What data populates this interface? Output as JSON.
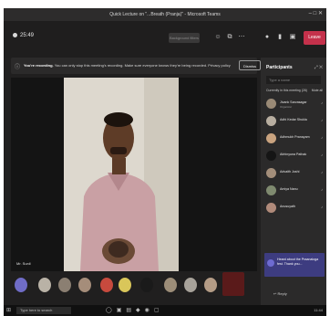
{
  "window": {
    "title": "Quick Lecture on \"...Breath (Pranja)\" - Microsoft Teams",
    "controls": "–  □  ✕"
  },
  "toolbar": {
    "timer": "25:49",
    "background_button": "Background filters",
    "tools": [
      "☺",
      "⧉",
      "⋯",
      "●",
      "▮",
      "▣"
    ],
    "leave_label": "Leave"
  },
  "banner": {
    "title": "You're recording.",
    "text": "You can only stop this meeting's recording. Make sure everyone knows they're being recorded. Privacy policy",
    "dismiss_label": "Dismiss"
  },
  "video": {
    "speaker_name": "Mr. Sunil"
  },
  "participants_panel": {
    "title": "Participants",
    "search_placeholder": "Type a name",
    "section_title": "Currently in this meeting (26)",
    "mute_all": "Mute all",
    "items": [
      {
        "name": "Jivank Sarvasagar",
        "role": "Organizer"
      },
      {
        "name": "Adhi Kedar Shukla",
        "role": ""
      },
      {
        "name": "Adhmukh Pranayam",
        "role": ""
      },
      {
        "name": "Abhinyuna Pathak",
        "role": ""
      },
      {
        "name": "Advaith Joshi",
        "role": ""
      },
      {
        "name": "Amiya Nanu",
        "role": ""
      },
      {
        "name": "Anusuyath",
        "role": ""
      }
    ]
  },
  "notification": {
    "text": "Heard about the Praanaloga fest. Thank you..."
  },
  "reply_label": "Reply",
  "taskbar": {
    "search_text": "Type here to search",
    "clock": "11:44"
  },
  "colors": {
    "leave_button": "#c4314b",
    "panel_bg": "#2b2a2a",
    "notification_bg": "#3d3c80"
  }
}
